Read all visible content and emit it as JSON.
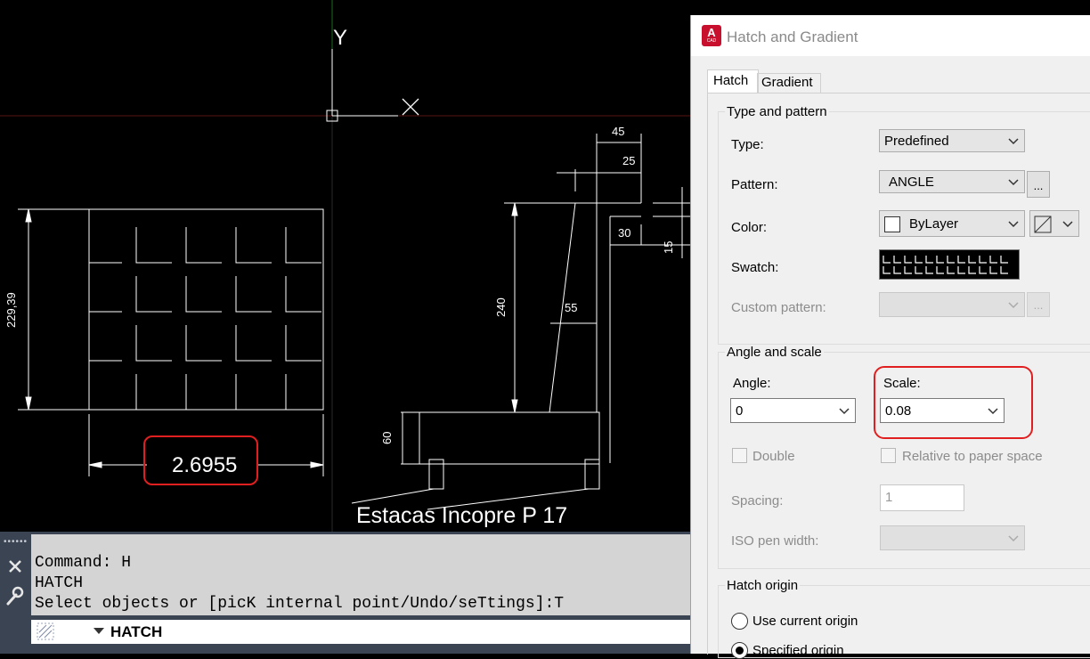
{
  "drawing": {
    "y_axis_label": "Y",
    "dim_overall_width": "2.6955",
    "dim_height_left": "229,39",
    "dim_45": "45",
    "dim_25": "25",
    "dim_30": "30",
    "dim_15": "15",
    "dim_240": "240",
    "dim_55": "55",
    "dim_60": "60",
    "annotation": "Estacas Incopre P 17",
    "highlight_color": "#e02020"
  },
  "command_line": {
    "history": [
      "Command: H",
      "HATCH",
      "Select objects or [picK internal point/Undo/seTtings]:T"
    ],
    "current_command": "HATCH"
  },
  "dialog": {
    "app_icon_letter": "A",
    "app_icon_sub": "CAD",
    "title": "Hatch and Gradient",
    "tabs": [
      "Hatch",
      "Gradient"
    ],
    "active_tab": "Hatch",
    "type_and_pattern": {
      "group_title": "Type and pattern",
      "type_label": "Type:",
      "type_value": "Predefined",
      "pattern_label": "Pattern:",
      "pattern_value": "ANGLE",
      "pattern_browse": "...",
      "color_label": "Color:",
      "color_value": "ByLayer",
      "swatch_label": "Swatch:",
      "custom_pattern_label": "Custom pattern:",
      "custom_browse": "..."
    },
    "angle_and_scale": {
      "group_title": "Angle and scale",
      "angle_label": "Angle:",
      "angle_value": "0",
      "scale_label": "Scale:",
      "scale_value": "0.08",
      "double_label": "Double",
      "relative_label": "Relative to paper space",
      "spacing_label": "Spacing:",
      "spacing_value": "1",
      "iso_pen_label": "ISO pen width:"
    },
    "hatch_origin": {
      "group_title": "Hatch origin",
      "use_current_label": "Use current origin",
      "specified_label": "Specified origin"
    }
  }
}
